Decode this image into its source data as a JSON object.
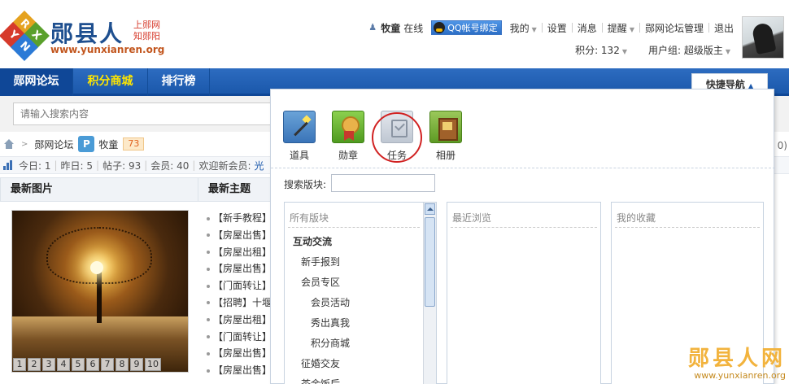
{
  "header": {
    "logo_letters": [
      "R",
      "Y",
      "X",
      "N"
    ],
    "logo_title": "郧县人",
    "logo_sub1": "上郧网",
    "logo_sub2": "知郧阳",
    "logo_url": "www.yunxianren.org",
    "username": "牧童",
    "online": "在线",
    "qq_bind": "QQ帐号绑定",
    "links": [
      "我的",
      "设置",
      "消息",
      "提醒",
      "郧网论坛管理",
      "退出"
    ],
    "points": "积分: 132",
    "usergroup": "用户组: 超级版主"
  },
  "nav": {
    "items": [
      "郧网论坛",
      "积分商城",
      "排行榜"
    ],
    "quicknav": "快捷导航"
  },
  "search": {
    "placeholder": "请输入搜索内容"
  },
  "breadcrumb": {
    "forum": "郧网论坛",
    "user": "牧童",
    "badge": "73"
  },
  "stats": {
    "today": "今日: 1",
    "yesterday": "昨日: 5",
    "posts": "帖子: 93",
    "members": "会员: 40",
    "welcome": "欢迎新会员:",
    "newmember": "光"
  },
  "blocks": {
    "photos_title": "最新图片",
    "topics_title": "最新主题",
    "pager": [
      "1",
      "2",
      "3",
      "4",
      "5",
      "6",
      "7",
      "8",
      "9",
      "10"
    ],
    "topics": [
      "【新手教程】",
      "【房屋出售】",
      "【房屋出租】",
      "【房屋出售】",
      "【门面转让】",
      "【招聘】十堰",
      "【房屋出租】",
      "【门面转让】",
      "【房屋出售】",
      "【房屋出售】"
    ]
  },
  "panel": {
    "tools": [
      {
        "label": "道具",
        "icon": "magic-wand-icon"
      },
      {
        "label": "勋章",
        "icon": "medal-icon"
      },
      {
        "label": "任务",
        "icon": "task-icon"
      },
      {
        "label": "相册",
        "icon": "album-icon"
      }
    ],
    "search_label": "搜索版块:",
    "all_title": "所有版块",
    "recent_title": "最近浏览",
    "fav_title": "我的收藏",
    "forums": [
      {
        "name": "互动交流",
        "level": 0
      },
      {
        "name": "新手报到",
        "level": 1
      },
      {
        "name": "会员专区",
        "level": 1
      },
      {
        "name": "会员活动",
        "level": 2
      },
      {
        "name": "秀出真我",
        "level": 2
      },
      {
        "name": "积分商城",
        "level": 2
      },
      {
        "name": "征婚交友",
        "level": 1
      },
      {
        "name": "茶余饭后",
        "level": 1
      }
    ]
  },
  "watermark": {
    "title": "郧县人网",
    "url": "www.yunxianren.org"
  },
  "right_clip": "0)"
}
